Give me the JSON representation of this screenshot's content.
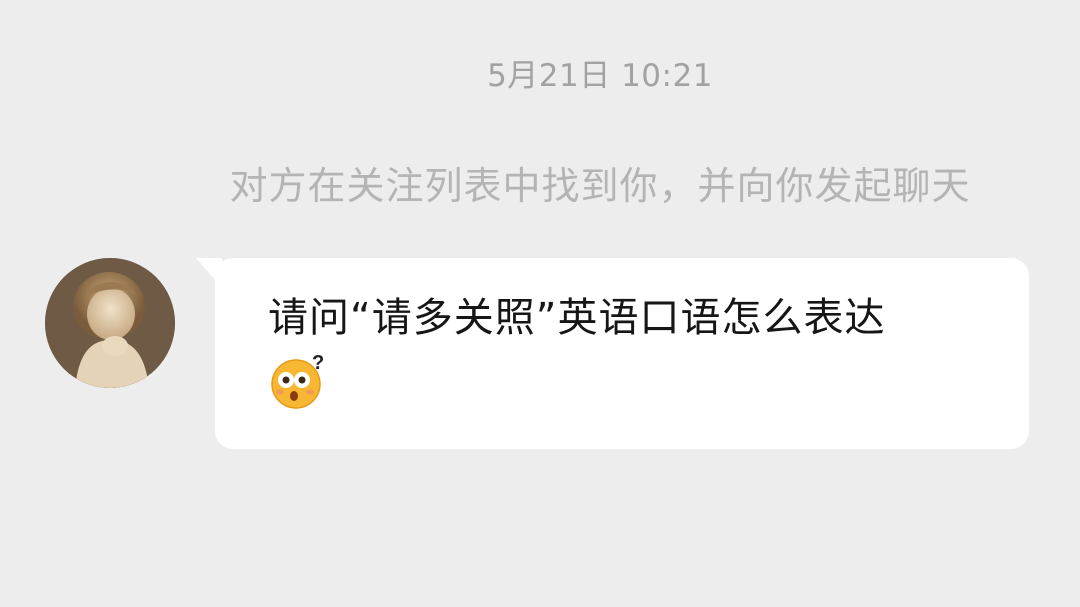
{
  "timestamp": "5月21日 10:21",
  "system_notice": "对方在关注列表中找到你，并向你发起聊天",
  "message": {
    "text": "请问“请多关照”英语口语怎么表达",
    "emoji_icon": "flushed-question-face-icon"
  },
  "colors": {
    "background": "#ededed",
    "bubble": "#ffffff",
    "timestamp": "#a2a2a2",
    "system_notice": "#b4b4b4",
    "message_text": "#161616"
  }
}
